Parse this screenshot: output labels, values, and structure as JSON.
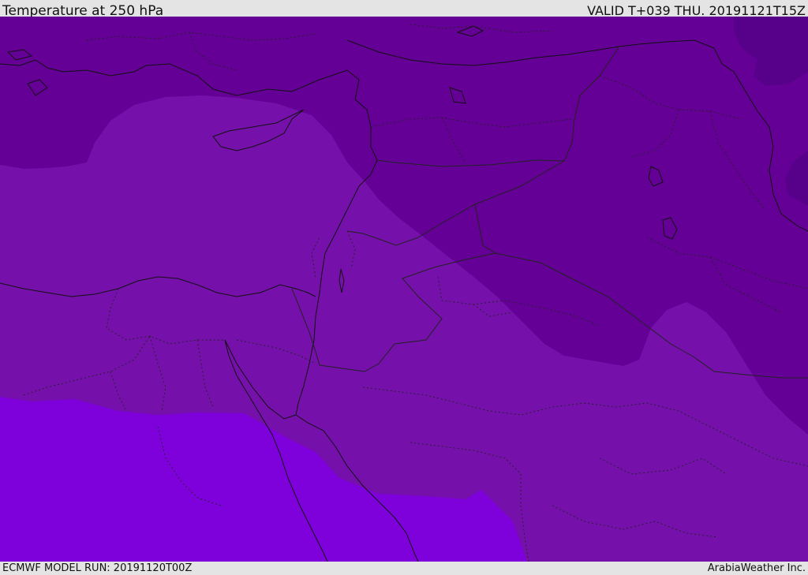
{
  "header": {
    "title": "Temperature at 250 hPa",
    "valid_time": "VALID T+039 THU. 20191121T15Z"
  },
  "footer": {
    "model_run": "ECMWF MODEL RUN: 20191120T00Z",
    "credit": "ArabiaWeather Inc."
  },
  "colors": {
    "coldest": "#57008a",
    "cold": "#650096",
    "mid": "#7510ab",
    "warm": "#7e00da",
    "coastline": "#111111",
    "border": "#222222"
  }
}
